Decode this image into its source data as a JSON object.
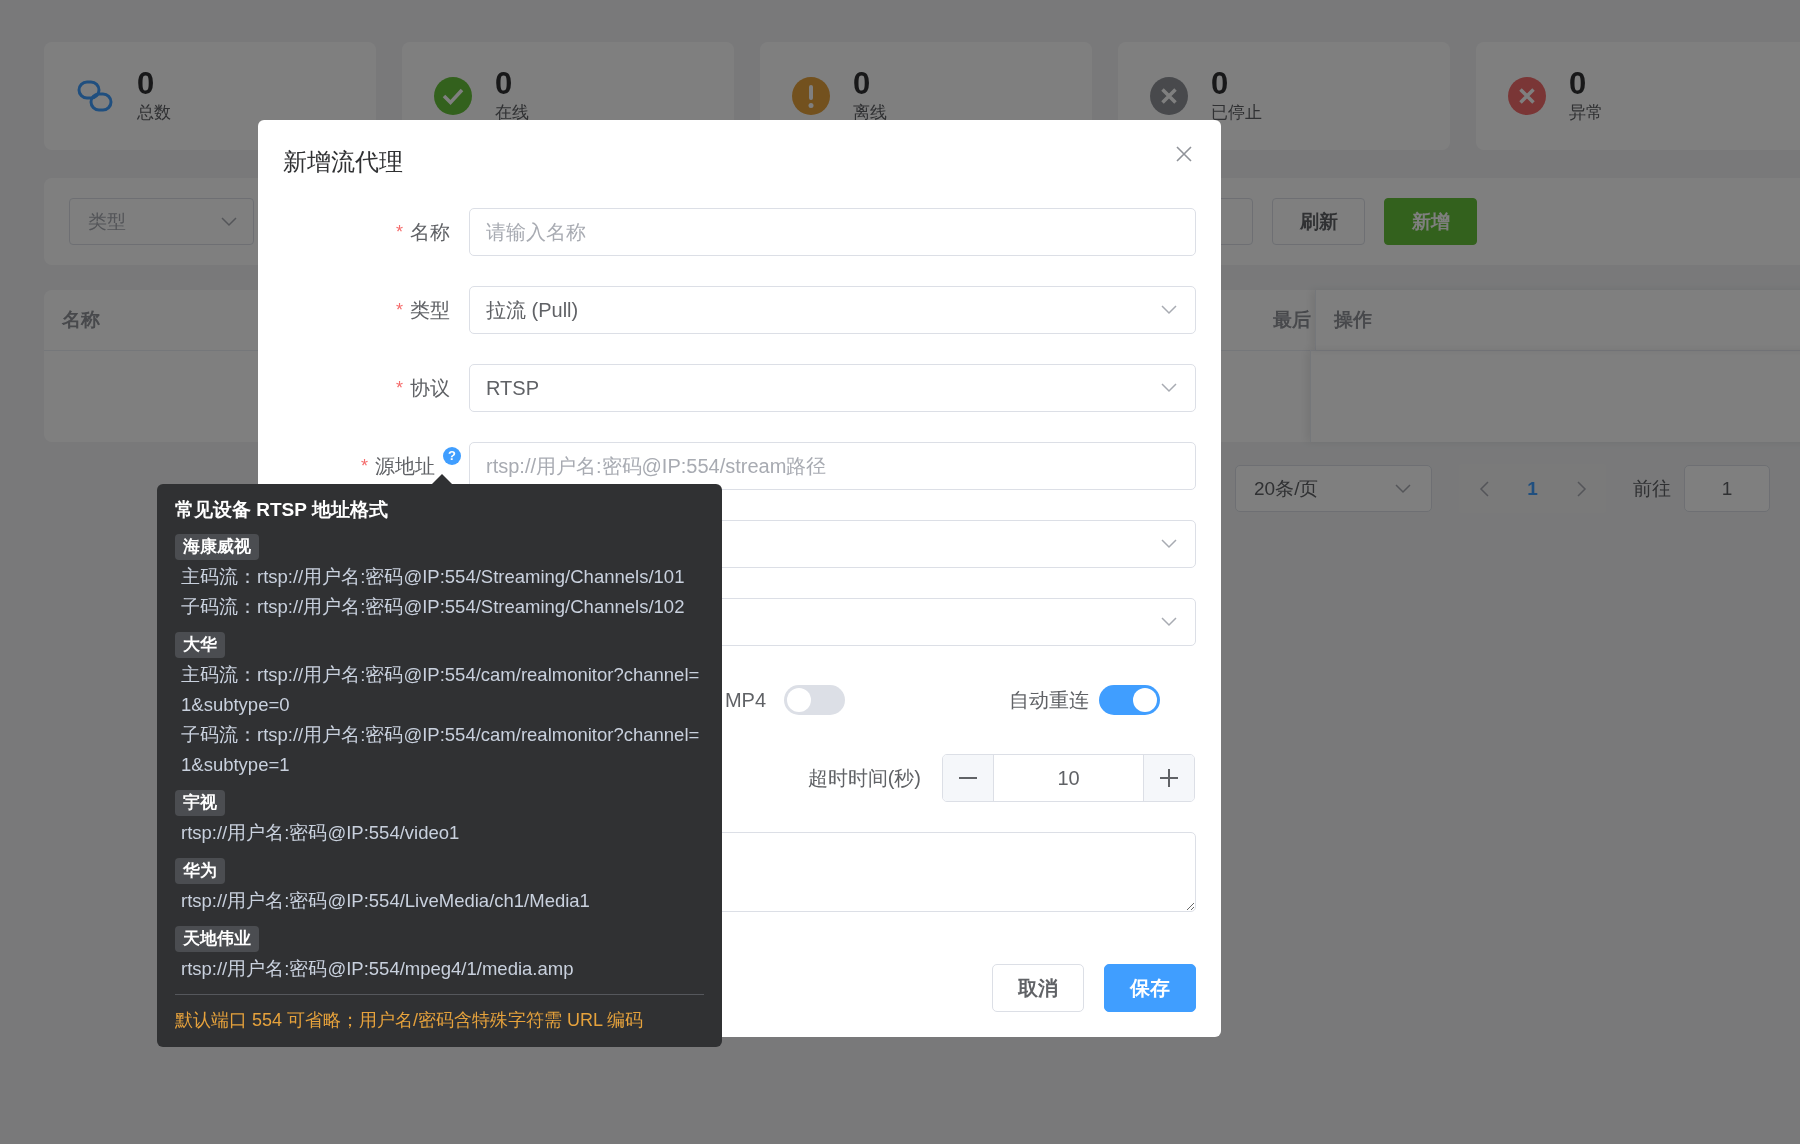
{
  "stats": [
    {
      "kind": "total",
      "value": "0",
      "label": "总数"
    },
    {
      "kind": "online",
      "value": "0",
      "label": "在线"
    },
    {
      "kind": "offline",
      "value": "0",
      "label": "离线"
    },
    {
      "kind": "stopped",
      "value": "0",
      "label": "已停止"
    },
    {
      "kind": "error",
      "value": "0",
      "label": "异常"
    }
  ],
  "toolbar": {
    "type_filter": {
      "placeholder": "类型"
    },
    "buttons": [
      {
        "kind": "default",
        "label": "刷新"
      },
      {
        "kind": "primary",
        "label": "新增"
      }
    ]
  },
  "table": {
    "columns": [
      "名称",
      "最后",
      "操作"
    ]
  },
  "pagination": {
    "page_size": "20条/页",
    "pages": [
      {
        "label": "1",
        "selected": true
      }
    ],
    "goto_label": "前往",
    "goto_value": "1"
  },
  "dialog": {
    "title": "新增流代理",
    "rows": [
      {
        "kind": "input",
        "mark": "*",
        "label": "名称",
        "placeholder": "请输入名称"
      },
      {
        "kind": "select",
        "mark": "*",
        "label": "类型",
        "value": "拉流 (Pull)"
      },
      {
        "kind": "select",
        "mark": "*",
        "label": "协议",
        "value": "RTSP"
      },
      {
        "kind": "input",
        "mark": "*",
        "label": "源地址",
        "help": "?",
        "placeholder": "rtsp://用户名:密码@IP:554/stream路径"
      },
      {
        "kind": "select"
      },
      {
        "kind": "select"
      },
      {
        "kind": "switches",
        "items": [
          {
            "label": "MP4",
            "on": false
          },
          {
            "label": "自动重连",
            "on": true
          }
        ]
      },
      {
        "kind": "number",
        "label": "超时时间(秒)",
        "value": "10"
      },
      {
        "kind": "textarea"
      }
    ],
    "buttons": [
      {
        "kind": "default",
        "label": "取消"
      },
      {
        "kind": "primary",
        "label": "保存"
      }
    ]
  },
  "tooltip": {
    "title": "常见设备 RTSP 地址格式",
    "groups": [
      {
        "vendor": "海康威视",
        "lines": [
          "主码流：rtsp://用户名:密码@IP:554/Streaming/Channels/101",
          "子码流：rtsp://用户名:密码@IP:554/Streaming/Channels/102"
        ]
      },
      {
        "vendor": "大华",
        "lines": [
          "主码流：rtsp://用户名:密码@IP:554/cam/realmonitor?channel=1&subtype=0",
          "子码流：rtsp://用户名:密码@IP:554/cam/realmonitor?channel=1&subtype=1"
        ]
      },
      {
        "vendor": "宇视",
        "lines": [
          "rtsp://用户名:密码@IP:554/video1"
        ]
      },
      {
        "vendor": "华为",
        "lines": [
          "rtsp://用户名:密码@IP:554/LiveMedia/ch1/Media1"
        ]
      },
      {
        "vendor": "天地伟业",
        "lines": [
          "rtsp://用户名:密码@IP:554/mpeg4/1/media.amp"
        ]
      }
    ],
    "note": "默认端口 554 可省略；用户名/密码含特殊字符需 URL 编码"
  }
}
